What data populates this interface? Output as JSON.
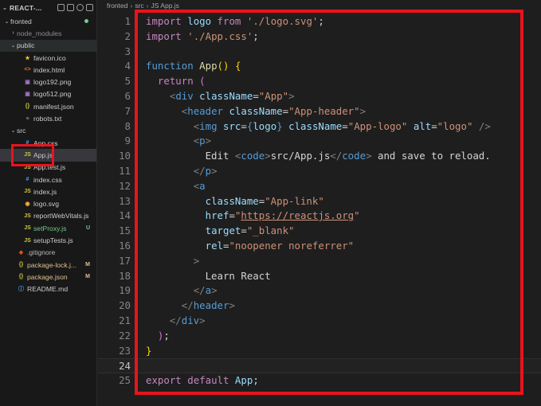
{
  "explorer": {
    "title": "REACT-...",
    "items": [
      {
        "label": "fronted",
        "kind": "folder-open",
        "icon": "",
        "badge": "",
        "dot": true
      },
      {
        "label": "node_modules",
        "kind": "folder",
        "icon": "",
        "badge": ""
      },
      {
        "label": "public",
        "kind": "folder-open",
        "icon": "",
        "badge": ""
      },
      {
        "label": "favicon.ico",
        "kind": "file",
        "icon": "★",
        "iconColor": "#f1c40f",
        "badge": ""
      },
      {
        "label": "index.html",
        "kind": "file",
        "icon": "<>",
        "iconColor": "#e37933",
        "badge": ""
      },
      {
        "label": "logo192.png",
        "kind": "file",
        "icon": "▣",
        "iconColor": "#a074c4",
        "badge": ""
      },
      {
        "label": "logo512.png",
        "kind": "file",
        "icon": "▣",
        "iconColor": "#a074c4",
        "badge": ""
      },
      {
        "label": "manifest.json",
        "kind": "file",
        "icon": "{}",
        "iconColor": "#cbcb41",
        "badge": ""
      },
      {
        "label": "robots.txt",
        "kind": "file",
        "icon": "≡",
        "iconColor": "#9d9d9d",
        "badge": ""
      },
      {
        "label": "src",
        "kind": "folder-open",
        "icon": "",
        "badge": ""
      },
      {
        "label": "App.css",
        "kind": "file",
        "icon": "#",
        "iconColor": "#42a5f5",
        "badge": ""
      },
      {
        "label": "App.js",
        "kind": "file",
        "icon": "JS",
        "iconColor": "#cbcb41",
        "badge": "",
        "selected": true
      },
      {
        "label": "App.test.js",
        "kind": "file",
        "icon": "JS",
        "iconColor": "#cbcb41",
        "badge": ""
      },
      {
        "label": "index.css",
        "kind": "file",
        "icon": "#",
        "iconColor": "#42a5f5",
        "badge": ""
      },
      {
        "label": "index.js",
        "kind": "file",
        "icon": "JS",
        "iconColor": "#cbcb41",
        "badge": ""
      },
      {
        "label": "logo.svg",
        "kind": "file",
        "icon": "◉",
        "iconColor": "#ffb13b",
        "badge": ""
      },
      {
        "label": "reportWebVitals.js",
        "kind": "file",
        "icon": "JS",
        "iconColor": "#cbcb41",
        "badge": ""
      },
      {
        "label": "setProxy.js",
        "kind": "file",
        "icon": "JS",
        "iconColor": "#cbcb41",
        "badge": "U",
        "labelColor": "#73c991"
      },
      {
        "label": "setupTests.js",
        "kind": "file",
        "icon": "JS",
        "iconColor": "#cbcb41",
        "badge": ""
      },
      {
        "label": ".gitignore",
        "kind": "file",
        "icon": "◆",
        "iconColor": "#e64a19",
        "badge": ""
      },
      {
        "label": "package-lock.j...",
        "kind": "file",
        "icon": "{}",
        "iconColor": "#cbcb41",
        "badge": "M",
        "labelColor": "#e2c08d"
      },
      {
        "label": "package.json",
        "kind": "file",
        "icon": "{}",
        "iconColor": "#cbcb41",
        "badge": "M",
        "labelColor": "#e2c08d"
      },
      {
        "label": "README.md",
        "kind": "file",
        "icon": "ⓘ",
        "iconColor": "#42a5f5",
        "badge": ""
      }
    ]
  },
  "breadcrumb": [
    "fronted",
    "src",
    "JS App.js"
  ],
  "editor": {
    "current_line": 24,
    "lines": [
      [
        [
          "kw",
          "import"
        ],
        [
          "txt",
          " "
        ],
        [
          "jsxv",
          "logo"
        ],
        [
          "txt",
          " "
        ],
        [
          "kw",
          "from"
        ],
        [
          "txt",
          " "
        ],
        [
          "str",
          "'./logo.svg'"
        ],
        [
          "txt",
          ";"
        ]
      ],
      [
        [
          "kw",
          "import"
        ],
        [
          "txt",
          " "
        ],
        [
          "str",
          "'./App.css'"
        ],
        [
          "txt",
          ";"
        ]
      ],
      [],
      [
        [
          "kw2",
          "function"
        ],
        [
          "txt",
          " "
        ],
        [
          "fn",
          "App"
        ],
        [
          "par",
          "()"
        ],
        [
          "txt",
          " "
        ],
        [
          "par",
          "{"
        ]
      ],
      [
        [
          "txt",
          "  "
        ],
        [
          "kw",
          "return"
        ],
        [
          "txt",
          " "
        ],
        [
          "par2",
          "("
        ]
      ],
      [
        [
          "txt",
          "    "
        ],
        [
          "br",
          "<"
        ],
        [
          "tag",
          "div"
        ],
        [
          "txt",
          " "
        ],
        [
          "attr",
          "className"
        ],
        [
          "txt",
          "="
        ],
        [
          "str",
          "\"App\""
        ],
        [
          "br",
          ">"
        ]
      ],
      [
        [
          "txt",
          "      "
        ],
        [
          "br",
          "<"
        ],
        [
          "tag",
          "header"
        ],
        [
          "txt",
          " "
        ],
        [
          "attr",
          "className"
        ],
        [
          "txt",
          "="
        ],
        [
          "str",
          "\"App-header\""
        ],
        [
          "br",
          ">"
        ]
      ],
      [
        [
          "txt",
          "        "
        ],
        [
          "br",
          "<"
        ],
        [
          "tag",
          "img"
        ],
        [
          "txt",
          " "
        ],
        [
          "attr",
          "src"
        ],
        [
          "txt",
          "="
        ],
        [
          "kw2",
          "{"
        ],
        [
          "jsxv",
          "logo"
        ],
        [
          "kw2",
          "}"
        ],
        [
          "txt",
          " "
        ],
        [
          "attr",
          "className"
        ],
        [
          "txt",
          "="
        ],
        [
          "str",
          "\"App-logo\""
        ],
        [
          "txt",
          " "
        ],
        [
          "attr",
          "alt"
        ],
        [
          "txt",
          "="
        ],
        [
          "str",
          "\"logo\""
        ],
        [
          "txt",
          " "
        ],
        [
          "br",
          "/>"
        ]
      ],
      [
        [
          "txt",
          "        "
        ],
        [
          "br",
          "<"
        ],
        [
          "tag",
          "p"
        ],
        [
          "br",
          ">"
        ]
      ],
      [
        [
          "txt",
          "          Edit "
        ],
        [
          "br",
          "<"
        ],
        [
          "tag",
          "code"
        ],
        [
          "br",
          ">"
        ],
        [
          "txt",
          "src/App.js"
        ],
        [
          "br",
          "</"
        ],
        [
          "tag",
          "code"
        ],
        [
          "br",
          ">"
        ],
        [
          "txt",
          " and save to reload."
        ]
      ],
      [
        [
          "txt",
          "        "
        ],
        [
          "br",
          "</"
        ],
        [
          "tag",
          "p"
        ],
        [
          "br",
          ">"
        ]
      ],
      [
        [
          "txt",
          "        "
        ],
        [
          "br",
          "<"
        ],
        [
          "tag",
          "a"
        ]
      ],
      [
        [
          "txt",
          "          "
        ],
        [
          "attr",
          "className"
        ],
        [
          "txt",
          "="
        ],
        [
          "str",
          "\"App-link\""
        ]
      ],
      [
        [
          "txt",
          "          "
        ],
        [
          "attr",
          "href"
        ],
        [
          "txt",
          "="
        ],
        [
          "str",
          "\""
        ],
        [
          "link",
          "https://reactjs.org"
        ],
        [
          "str",
          "\""
        ]
      ],
      [
        [
          "txt",
          "          "
        ],
        [
          "attr",
          "target"
        ],
        [
          "txt",
          "="
        ],
        [
          "str",
          "\"_blank\""
        ]
      ],
      [
        [
          "txt",
          "          "
        ],
        [
          "attr",
          "rel"
        ],
        [
          "txt",
          "="
        ],
        [
          "str",
          "\"noopener noreferrer\""
        ]
      ],
      [
        [
          "txt",
          "        "
        ],
        [
          "br",
          ">"
        ]
      ],
      [
        [
          "txt",
          "          Learn React"
        ]
      ],
      [
        [
          "txt",
          "        "
        ],
        [
          "br",
          "</"
        ],
        [
          "tag",
          "a"
        ],
        [
          "br",
          ">"
        ]
      ],
      [
        [
          "txt",
          "      "
        ],
        [
          "br",
          "</"
        ],
        [
          "tag",
          "header"
        ],
        [
          "br",
          ">"
        ]
      ],
      [
        [
          "txt",
          "    "
        ],
        [
          "br",
          "</"
        ],
        [
          "tag",
          "div"
        ],
        [
          "br",
          ">"
        ]
      ],
      [
        [
          "txt",
          "  "
        ],
        [
          "par2",
          ")"
        ],
        [
          "txt",
          ";"
        ]
      ],
      [
        [
          "par",
          "}"
        ]
      ],
      [],
      [
        [
          "kw",
          "export"
        ],
        [
          "txt",
          " "
        ],
        [
          "kw",
          "default"
        ],
        [
          "txt",
          " "
        ],
        [
          "jsxv",
          "App"
        ],
        [
          "txt",
          ";"
        ]
      ]
    ]
  },
  "annotations": {
    "highlight_color": "#e8141c"
  }
}
